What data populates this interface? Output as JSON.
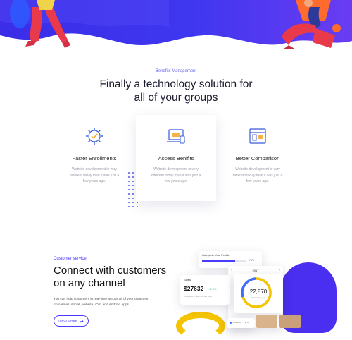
{
  "benefits": {
    "eyebrow": "Benefits Management",
    "title_line1": "Finally a technology solution for",
    "title_line2": "all of your groups",
    "cards": [
      {
        "title": "Faster Enrollments",
        "desc1": "Website development is very",
        "desc2": "different today than it was just a",
        "desc3": "few years ago.",
        "icon": "gear-check-icon"
      },
      {
        "title": "Access Benifits",
        "desc1": "Website development is very",
        "desc2": "different today than it was just a",
        "desc3": "few years ago.",
        "icon": "devices-icon"
      },
      {
        "title": "Better Comparison",
        "desc1": "Website development is very",
        "desc2": "different today than it was just a",
        "desc3": "few years ago.",
        "icon": "compare-window-icon"
      }
    ]
  },
  "customer_service": {
    "label": "Customer service",
    "title_line1": "Connect with customers",
    "title_line2": "on any channel",
    "desc_line1": "You can help customers in real-time across all of your channels",
    "desc_line2": "from email, social, website, iOS, and Android apps.",
    "button_label": "VIEW MORE"
  },
  "mockup": {
    "profile_title": "Complete Your Profile",
    "profile_value": "75%",
    "year": "2017",
    "sales_label": "Sales",
    "sales_value": "$27632",
    "sales_change": "+2.6%",
    "sales_note": "Compared to ($21,340 last year)",
    "ring_value": "22,870",
    "ring_label": "Visitors this year",
    "legend_label": "Amazon",
    "legend_value": "$ 74"
  },
  "colors": {
    "accent": "#4b3bff",
    "hero_blue": "#3f37f0",
    "hero_purple": "#7a3cf0",
    "card_icon": "#3a5bd8",
    "icon_orange": "#f5a623",
    "ring_yellow": "#f5c400",
    "ring_blue": "#3f6bff"
  }
}
